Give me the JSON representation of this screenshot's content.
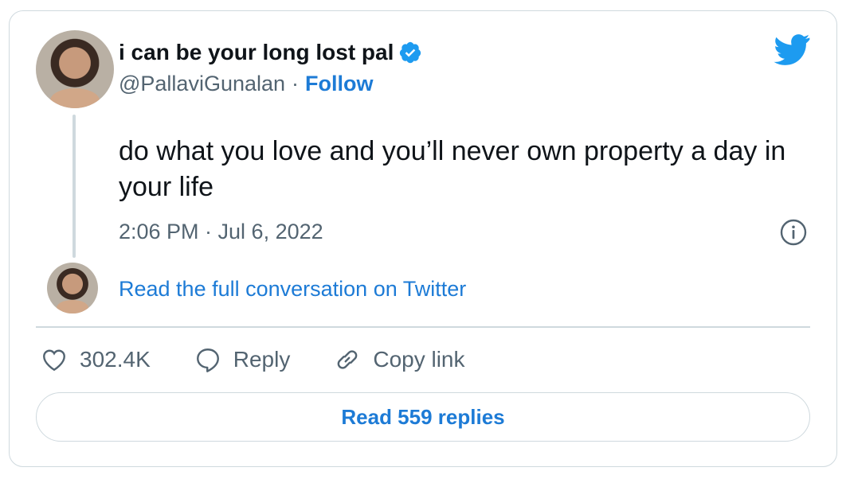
{
  "author": {
    "name": "i can be your long lost pal",
    "handle": "@PallaviGunalan",
    "separator": "·",
    "follow_label": "Follow"
  },
  "tweet": {
    "text": "do what you love and you’ll never own property a day in your life",
    "timestamp": "2:06 PM · Jul 6, 2022"
  },
  "conversation_link": "Read the full conversation on Twitter",
  "actions": {
    "likes": "302.4K",
    "reply_label": "Reply",
    "copy_label": "Copy link"
  },
  "replies_button": "Read 559 replies",
  "colors": {
    "accent": "#1d7bd6",
    "twitter_blue": "#1d9bf0",
    "muted": "#536471",
    "border": "#cfd9de"
  },
  "icons": [
    "verified-badge-icon",
    "twitter-bird-icon",
    "info-icon",
    "heart-icon",
    "reply-bubble-icon",
    "link-icon"
  ]
}
